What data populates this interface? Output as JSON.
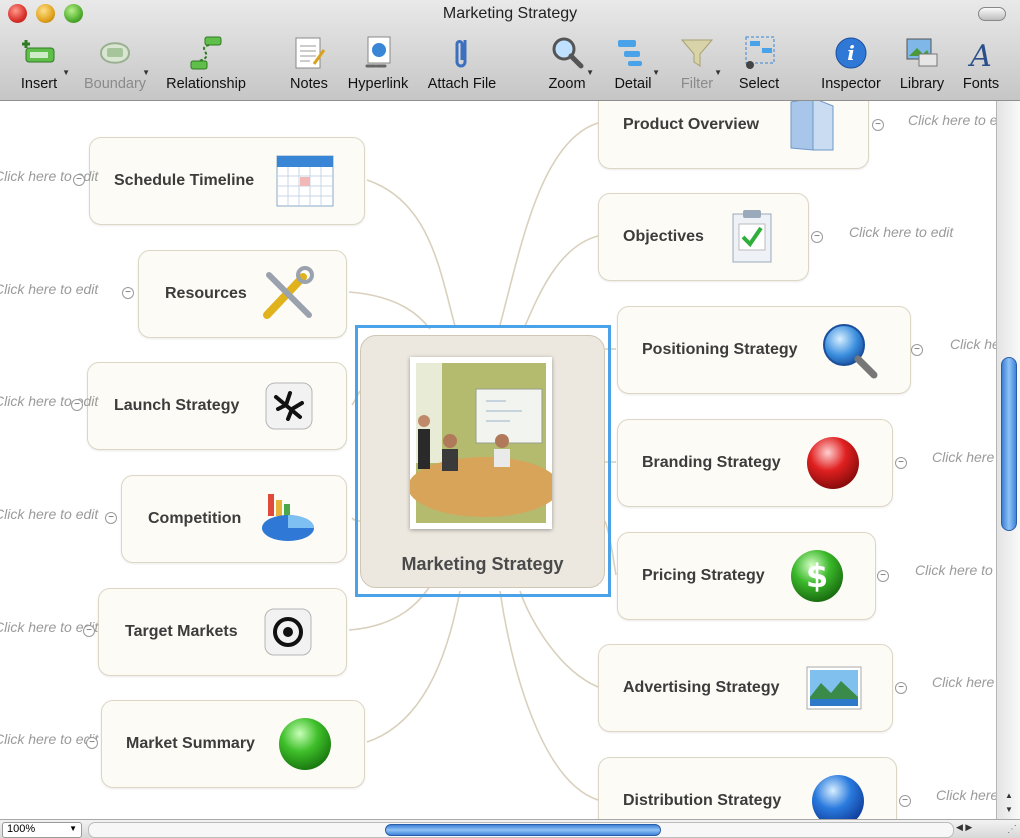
{
  "window": {
    "title": "Marketing Strategy"
  },
  "toolbar": {
    "insert": "Insert",
    "boundary": "Boundary",
    "relationship": "Relationship",
    "notes": "Notes",
    "hyperlink": "Hyperlink",
    "attach_file": "Attach File",
    "zoom": "Zoom",
    "detail": "Detail",
    "filter": "Filter",
    "select": "Select",
    "inspector": "Inspector",
    "library": "Library",
    "fonts": "Fonts"
  },
  "map": {
    "central": "Marketing Strategy",
    "note_placeholder": "Click here to edit",
    "left_topics": [
      {
        "label": "Schedule Timeline",
        "icon": "calendar-icon"
      },
      {
        "label": "Resources",
        "icon": "tools-icon"
      },
      {
        "label": "Launch Strategy",
        "icon": "airplane-icon"
      },
      {
        "label": "Competition",
        "icon": "pie-chart-icon"
      },
      {
        "label": "Target Markets",
        "icon": "target-icon"
      },
      {
        "label": "Market Summary",
        "icon": "green-ball-icon"
      }
    ],
    "right_topics": [
      {
        "label": "Product Overview",
        "icon": "folder-icon"
      },
      {
        "label": "Objectives",
        "icon": "clipboard-check-icon"
      },
      {
        "label": "Positioning Strategy",
        "icon": "magnifier-icon"
      },
      {
        "label": "Branding Strategy",
        "icon": "red-ball-icon"
      },
      {
        "label": "Pricing Strategy",
        "icon": "dollar-icon"
      },
      {
        "label": "Advertising Strategy",
        "icon": "landscape-photo-icon"
      },
      {
        "label": "Distribution Strategy",
        "icon": "blue-ball-icon"
      }
    ]
  },
  "statusbar": {
    "zoom_value": "100%"
  },
  "colors": {
    "selection": "#4aa3e8",
    "node_border": "#ddd6c4",
    "connector": "#d9d1bd"
  }
}
